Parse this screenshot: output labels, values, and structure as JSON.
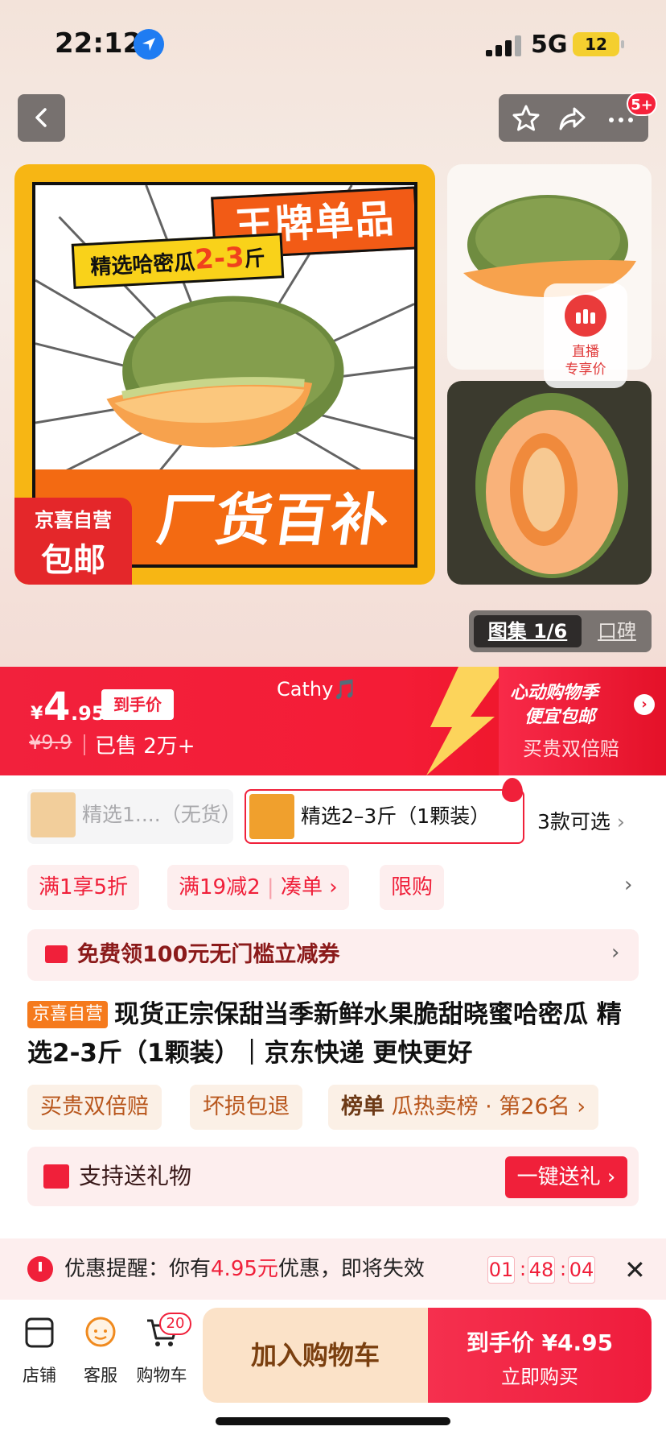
{
  "status_bar": {
    "time": "22:12",
    "network": "5G",
    "battery": "12"
  },
  "header": {
    "notification_badge": "5+"
  },
  "main_image": {
    "banner_red": "王牌单品",
    "banner_yellow_prefix": "精选哈密瓜",
    "banner_yellow_highlight": "2-3",
    "banner_yellow_suffix": "斤",
    "bottom_slogan": "厂货百补",
    "tag_line1": "京喜自营",
    "tag_line2": "包邮"
  },
  "live_badge": {
    "line1": "直播",
    "line2": "专享价"
  },
  "gallery": {
    "active": "图集 1/6",
    "inactive": "口碑"
  },
  "price": {
    "symbol": "¥",
    "integer": "4",
    "decimal": ".95",
    "tag": "到手价",
    "original": "¥9.9",
    "sold": "已售 2万+",
    "user": "Cathy🎵"
  },
  "promo": {
    "line1": "心动购物季",
    "line2": "便宜包邮",
    "line3": "买贵双倍赔"
  },
  "variants": {
    "items": [
      {
        "label": "精选1....（无货）"
      },
      {
        "label": "精选2–3斤（1颗装）"
      }
    ],
    "more": "3款可选"
  },
  "coupons": [
    "满1享5折",
    "满19减2",
    "凑单",
    "限购"
  ],
  "voucher": {
    "text": "免费领100元无门槛立减券"
  },
  "product": {
    "self_tag": "京喜自营",
    "title": "现货正宗保甜当季新鲜水果脆甜晓蜜哈密瓜 精选2-3斤（1颗装）｜京东快递 更快更好"
  },
  "guarantees": {
    "double_pay": "买贵双倍赔",
    "damage": "坏损包退",
    "rank_label": "榜单",
    "rank_text": "瓜热卖榜 · 第26名"
  },
  "gift": {
    "text": "支持送礼物",
    "button": "一键送礼"
  },
  "reminder": {
    "prefix": "优惠提醒：你有",
    "amount": "4.95元",
    "suffix": "优惠，即将失效",
    "hours": "01",
    "minutes": "48",
    "seconds": "04"
  },
  "bottom_nav": {
    "store": "店铺",
    "service": "客服",
    "cart": "购物车",
    "cart_count": "20",
    "add_cart": "加入购物车",
    "buy_line1": "到手价 ¥4.95",
    "buy_line2": "立即购买"
  },
  "colors": {
    "accent": "#f0203a",
    "orange": "#f57a1d",
    "cart_bg": "#fbe2c8"
  }
}
